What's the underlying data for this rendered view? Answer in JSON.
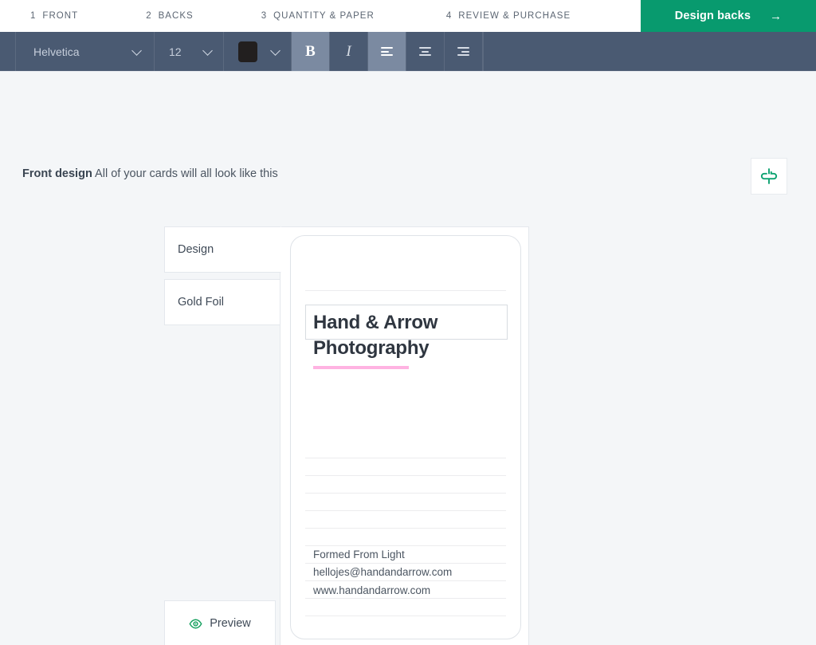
{
  "stepbar": {
    "steps": [
      {
        "num": "1",
        "label": "FRONT"
      },
      {
        "num": "2",
        "label": "BACKS"
      },
      {
        "num": "3",
        "label": "QUANTITY & PAPER"
      },
      {
        "num": "4",
        "label": "REVIEW & PURCHASE"
      }
    ],
    "cta": {
      "label": "Design backs",
      "arrow": "→",
      "color": "#089a6e"
    }
  },
  "toolbar": {
    "background": "#4a5a72",
    "active_background": "#7b8aa1",
    "font_family": "Helvetica",
    "font_size": "12",
    "text_color_swatch": "#221f1f",
    "bold_label": "B",
    "bold_active": true,
    "italic_label": "I",
    "italic_active": false,
    "align_left_active": true,
    "align_center_active": false,
    "align_right_active": false,
    "chevron_icon": "chevron-down-icon"
  },
  "page": {
    "heading_label": "Front design",
    "heading_sub": "All of your cards will all look like this",
    "flip_icon": "flip-card-icon",
    "flip_icon_color": "#0fa372"
  },
  "sidebar": {
    "tabs": [
      {
        "label": "Design",
        "active": true
      },
      {
        "label": "Gold Foil",
        "active": false
      }
    ],
    "preview": {
      "label": "Preview",
      "icon": "eye-icon",
      "icon_color": "#15a05e"
    }
  },
  "card": {
    "accent_color": "#ffb3e2",
    "title_line1": "Hand & Arrow",
    "title_line2": "Photography",
    "contact": [
      "Formed From Light",
      "hellojes@handandarrow.com",
      "www.handandarrow.com"
    ],
    "guide_positions": [
      68,
      278,
      300,
      322,
      344,
      366,
      388,
      410,
      432,
      454,
      476
    ]
  }
}
